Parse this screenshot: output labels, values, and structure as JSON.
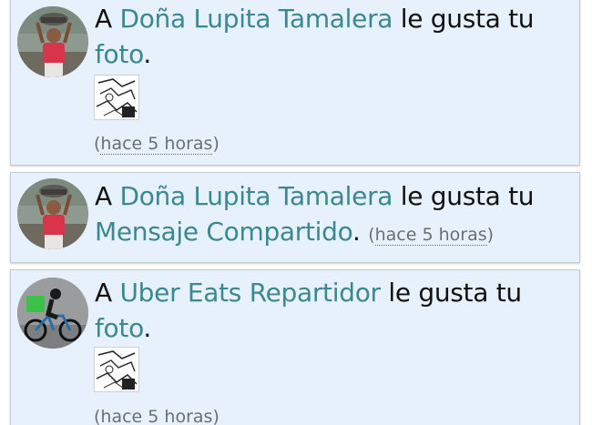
{
  "notifications": [
    {
      "prefix": "A",
      "user": "Doña Lupita Tamalera",
      "verb": "le gusta tu",
      "object": "foto",
      "suffix": ".",
      "time_open": "(",
      "time": "hace 5 horas",
      "time_close": ")",
      "avatar_icon": "avatar-woman-carrying-basket",
      "has_thumbnail": true
    },
    {
      "prefix": "A",
      "user": "Doña Lupita Tamalera",
      "verb": "le gusta tu",
      "object": "Mensaje Compartido",
      "suffix": ".",
      "time_open": "(",
      "time": "hace 5 horas",
      "time_close": ")",
      "avatar_icon": "avatar-woman-carrying-basket",
      "has_thumbnail": false
    },
    {
      "prefix": "A",
      "user": "Uber Eats Repartidor",
      "verb": "le gusta tu",
      "object": "foto",
      "suffix": ".",
      "time_open": "(",
      "time": "hace 5 horas",
      "time_close": ")",
      "avatar_icon": "avatar-cyclist-delivery",
      "has_thumbnail": true
    }
  ],
  "colors": {
    "card_background": "#e6f1fc",
    "link": "#3a8891",
    "text": "#111111",
    "timestamp": "#6a6f74"
  }
}
